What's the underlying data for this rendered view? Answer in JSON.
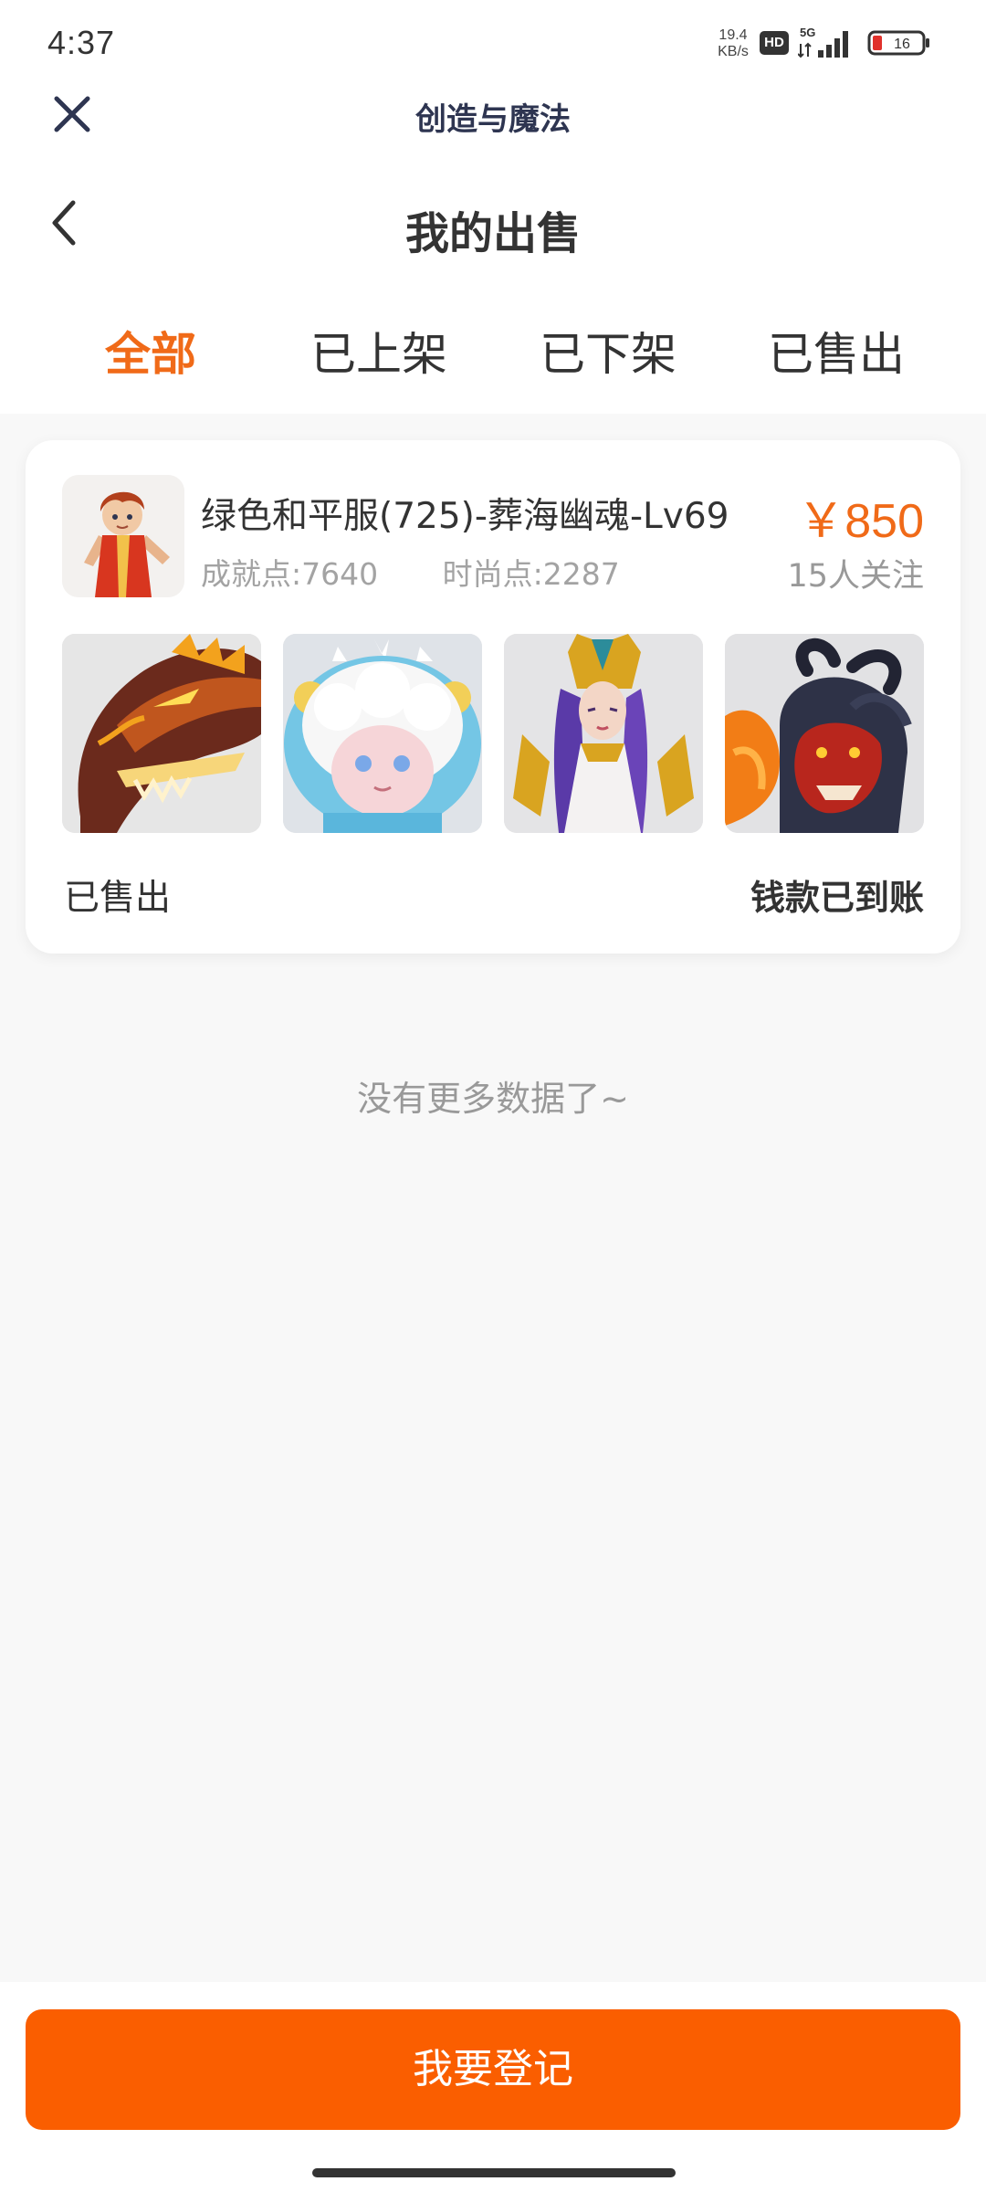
{
  "status_bar": {
    "time": "4:37",
    "net_speed_value": "19.4",
    "net_speed_unit": "KB/s",
    "hd_label": "HD",
    "network_label": "5G",
    "battery_level": "16",
    "battery_color": "#e0312b",
    "icons": [
      "signal-icon",
      "battery-icon"
    ]
  },
  "app_header": {
    "title": "创造与魔法",
    "icons": [
      "close-icon"
    ]
  },
  "page_header": {
    "title": "我的出售",
    "icons": [
      "back-icon"
    ]
  },
  "tabs": [
    {
      "label": "全部",
      "active": true
    },
    {
      "label": "已上架",
      "active": false
    },
    {
      "label": "已下架",
      "active": false
    },
    {
      "label": "已售出",
      "active": false
    }
  ],
  "orders": [
    {
      "title": "绿色和平服(725)-葬海幽魂-Lv69",
      "achievement_points": "成就点:7640",
      "fashion_points": "时尚点:2287",
      "price": "￥850",
      "followers": "15人关注",
      "status": "已售出",
      "payment_status": "钱款已到账",
      "thumbnails": [
        "dragon-mount-image",
        "fluffy-pet-image",
        "priestess-outfit-image",
        "beast-mount-image"
      ]
    }
  ],
  "list_footer": "没有更多数据了~",
  "bottom": {
    "register_button": "我要登记"
  },
  "colors": {
    "accent": "#f06a18",
    "button": "#fa5e00",
    "background": "#f8f8f8",
    "text_primary": "#333333",
    "text_secondary": "#999999"
  }
}
